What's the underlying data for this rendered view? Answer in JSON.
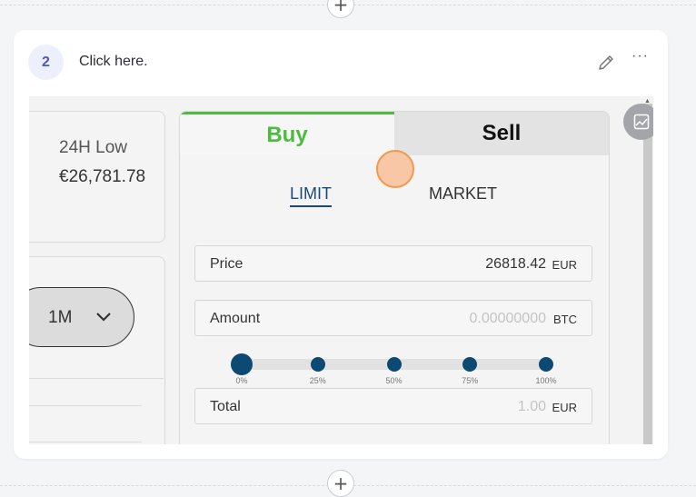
{
  "step": {
    "number": "2",
    "instruction": "Click here."
  },
  "add_control": {
    "symbol": "+"
  },
  "menu": {
    "symbol": "···"
  },
  "screenshot": {
    "stats": {
      "label": "24H Low",
      "value": "€26,781.78"
    },
    "range_selector": {
      "value": "1M"
    },
    "trade": {
      "tabs": {
        "buy": "Buy",
        "sell": "Sell"
      },
      "order_types": {
        "limit": "LIMIT",
        "market": "MARKET"
      },
      "price": {
        "label": "Price",
        "value": "26818.42",
        "unit": "EUR"
      },
      "amount": {
        "label": "Amount",
        "placeholder": "0.00000000",
        "unit": "BTC"
      },
      "slider": {
        "ticks": [
          "0%",
          "25%",
          "50%",
          "75%",
          "100%"
        ],
        "value_percent": 0
      },
      "total": {
        "label": "Total",
        "placeholder": "1.00",
        "unit": "EUR"
      }
    }
  },
  "colors": {
    "step_badge": "#4a58c8",
    "buy": "#4dbb3f",
    "accent_blue": "#0c4a73",
    "click_marker": "#f19a4f"
  },
  "icons": [
    "plus-icon",
    "pencil-icon",
    "more-icon",
    "chevron-down-icon",
    "image-icon"
  ]
}
